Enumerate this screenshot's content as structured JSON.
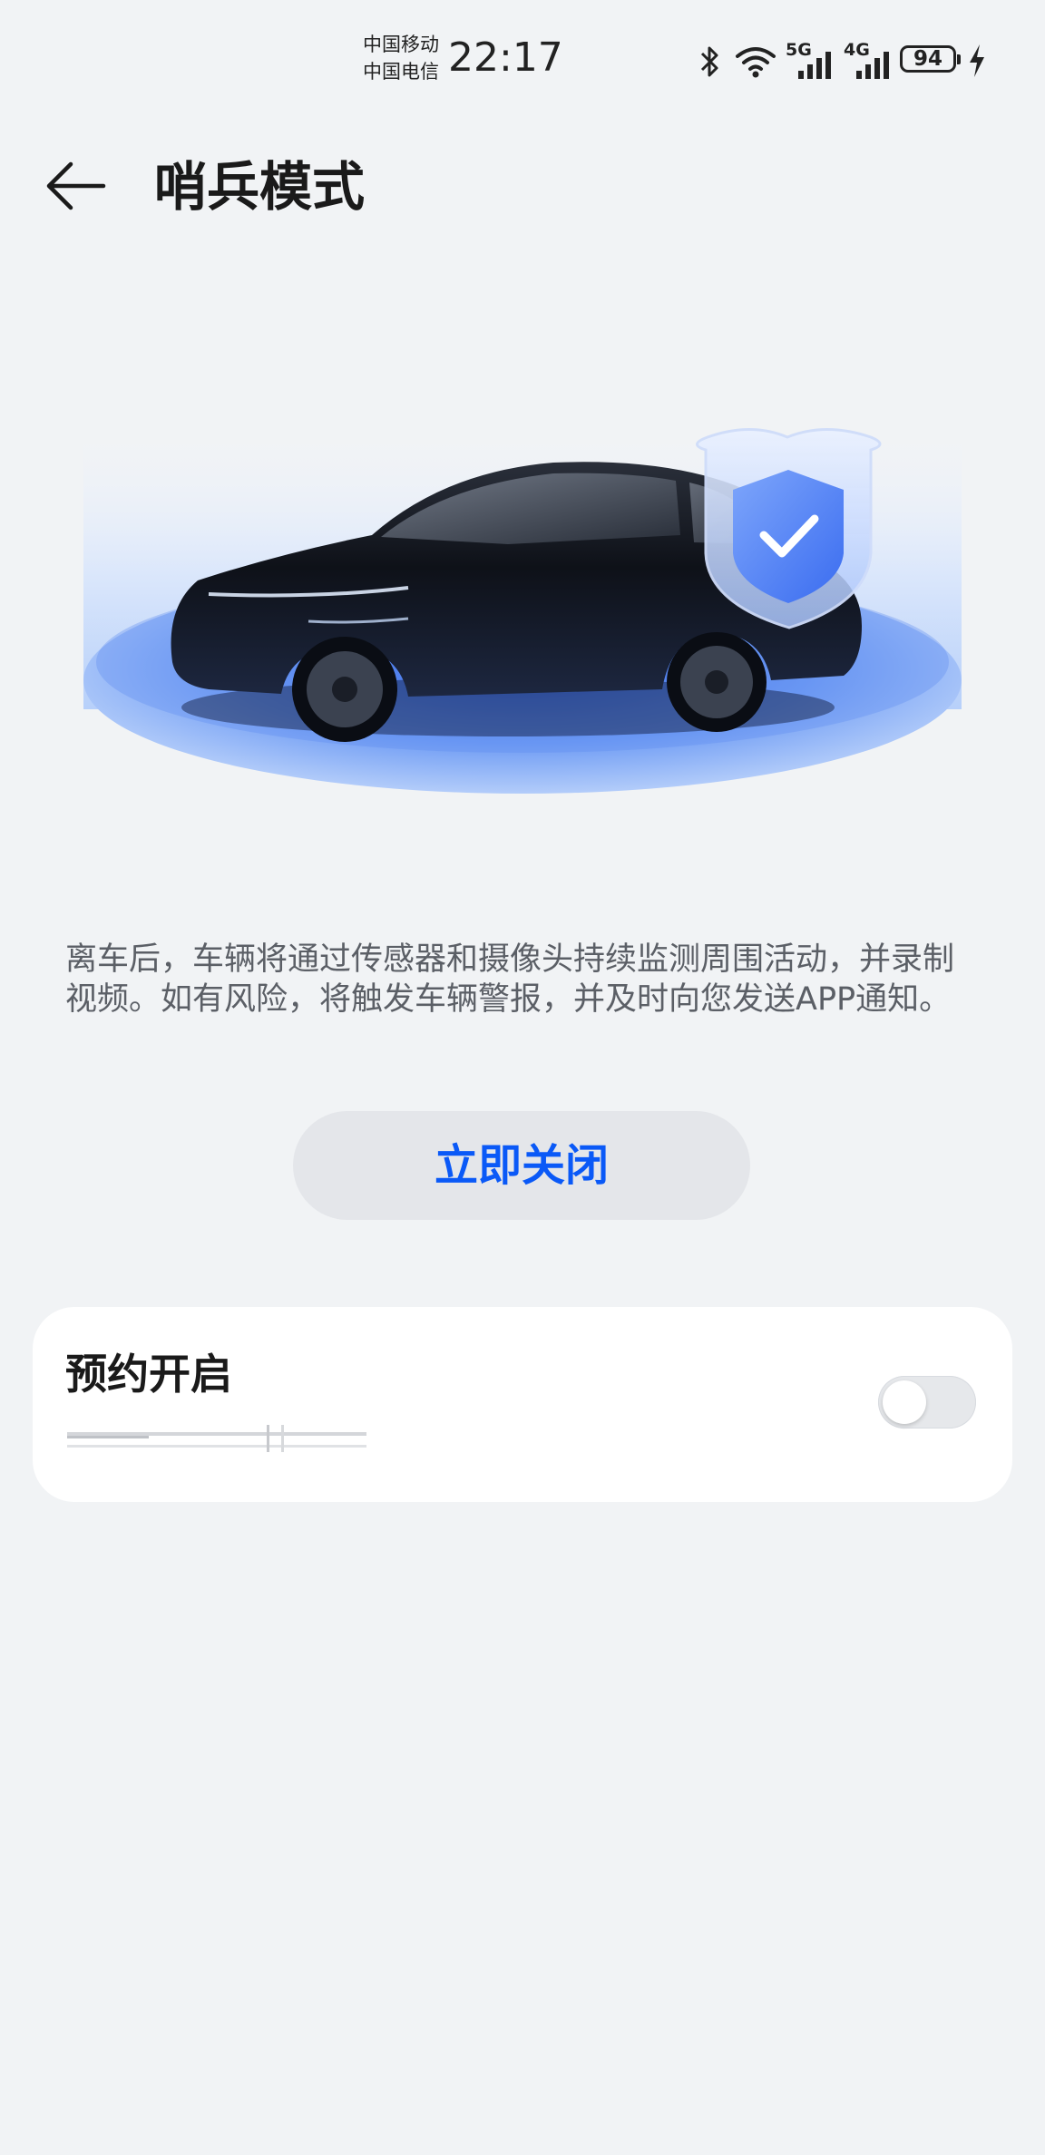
{
  "status_bar": {
    "carrier_1": "中国移动",
    "carrier_2": "中国电信",
    "time": "22:17",
    "network_1": "5G",
    "network_2": "4G",
    "battery": "94",
    "icons": [
      "bluetooth-icon",
      "wifi-icon",
      "signal-5g-icon",
      "signal-4g-icon",
      "battery-icon",
      "charging-icon"
    ]
  },
  "header": {
    "title": "哨兵模式",
    "back_icon": "back-arrow-icon"
  },
  "hero": {
    "image": "black-sedan-with-shield-check",
    "accent": "#3f7cf2"
  },
  "description": "离车后，车辆将通过传感器和摄像头持续监测周围活动，并录制视频。如有风险，将触发车辆警报，并及时向您发送APP通知。",
  "actions": {
    "close_now_label": "立即关闭",
    "accent": "#0a59f7"
  },
  "schedule": {
    "title": "预约开启",
    "enabled": false
  }
}
